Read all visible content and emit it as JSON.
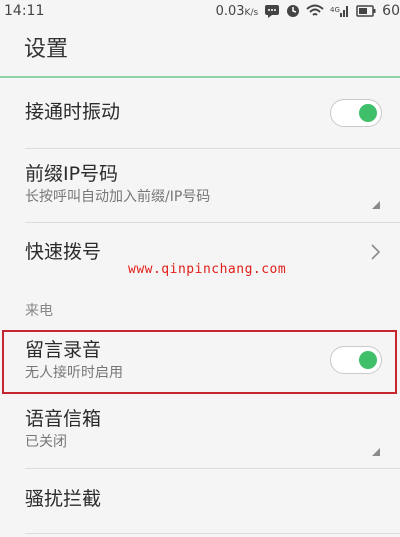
{
  "status": {
    "time": "14:11",
    "net_speed": "0.03",
    "net_unit": "K/s",
    "battery_level": "60"
  },
  "header": {
    "title": "设置"
  },
  "settings": [
    {
      "title": "接通时振动",
      "control": "toggle",
      "on": true
    },
    {
      "title": "前缀IP号码",
      "subtitle": "长按呼叫自动加入前缀/IP号码",
      "control": "dropdown"
    },
    {
      "title": "快速拨号",
      "control": "chevron"
    }
  ],
  "section_incoming": {
    "header": "来电",
    "items": [
      {
        "title": "留言录音",
        "subtitle": "无人接听时启用",
        "control": "toggle",
        "on": true
      },
      {
        "title": "语音信箱",
        "subtitle": "已关闭",
        "control": "dropdown"
      },
      {
        "title": "骚扰拦截",
        "control": "none"
      }
    ]
  },
  "watermark": {
    "text": "www.qinpinchang.com"
  },
  "colors": {
    "accent": "#3fbf6a",
    "highlight_box": "#c6262e",
    "watermark": "#e0201a"
  }
}
